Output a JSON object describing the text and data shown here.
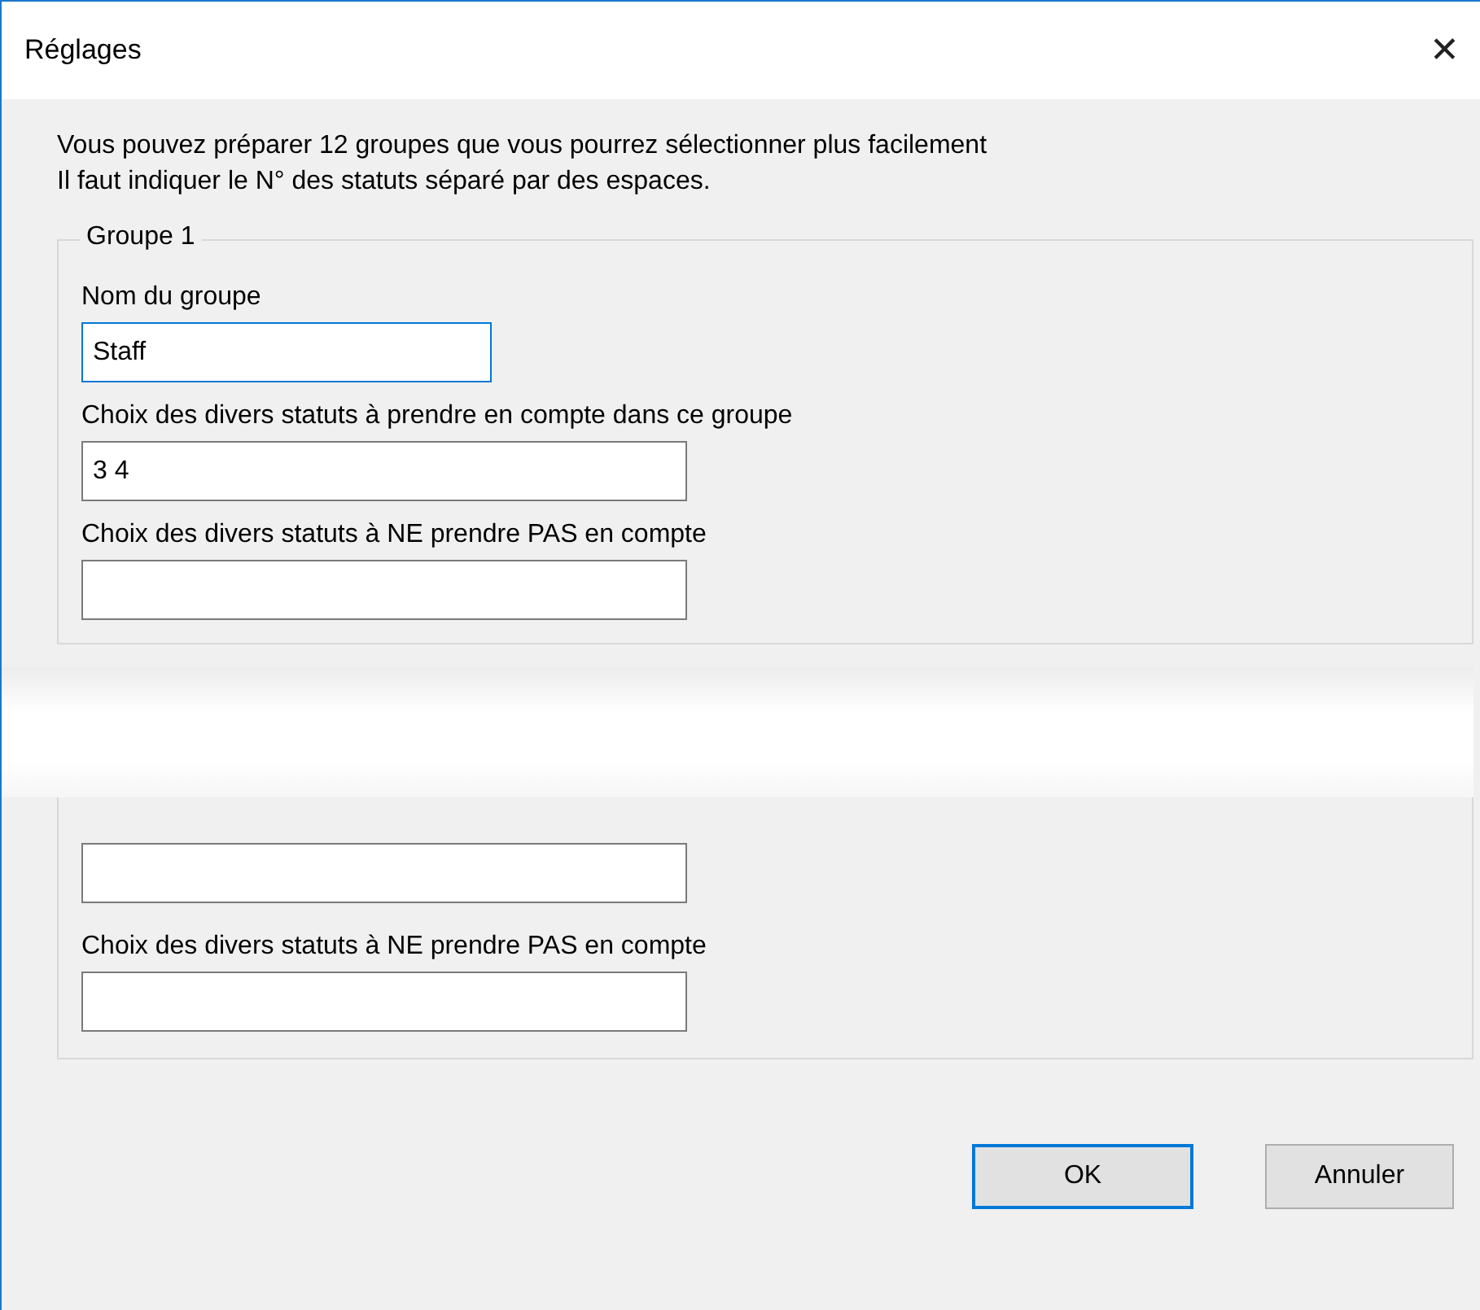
{
  "window": {
    "title": "Réglages",
    "close": "✕"
  },
  "intro": [
    "Vous pouvez préparer 12 groupes que vous pourrez sélectionner plus facilement",
    "Il faut indiquer le N° des statuts séparé par des espaces."
  ],
  "groups": [
    {
      "legend": "Groupe 1",
      "kind": "full",
      "fields": [
        {
          "label": "Nom du groupe",
          "value": "Staff",
          "focused": true,
          "kind": "short"
        },
        {
          "label": "Choix des divers statuts à prendre en compte dans ce groupe",
          "value": "3 4",
          "focused": false,
          "kind": "wide"
        },
        {
          "label": "Choix des divers statuts à NE prendre PAS en compte",
          "focused": false,
          "kind": "wide"
        }
      ]
    },
    {
      "kind": "partial",
      "fields": [
        {
          "focused": false,
          "kind": "wide"
        },
        {
          "label": "Choix des divers statuts à NE prendre PAS en compte",
          "focused": false,
          "kind": "wide"
        }
      ]
    }
  ],
  "buttons": [
    {
      "label": "OK",
      "selected": true
    },
    {
      "label": "Annuler",
      "selected": false
    }
  ]
}
